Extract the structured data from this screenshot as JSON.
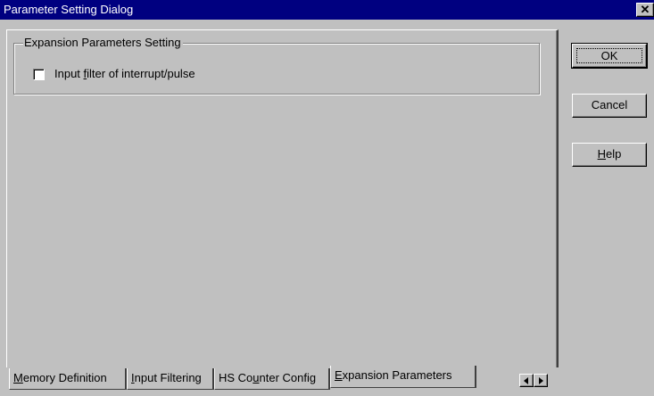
{
  "window": {
    "title": "Parameter Setting Dialog",
    "close_glyph": "✕"
  },
  "group": {
    "label": "Expansion Parameters Setting",
    "checkbox": {
      "label_pre": "Input ",
      "label_accel": "f",
      "label_post": "ilter of interrupt/pulse",
      "checked": false
    }
  },
  "buttons": {
    "ok": "OK",
    "cancel": "Cancel",
    "help_accel": "H",
    "help_rest": "elp"
  },
  "tabs": [
    {
      "accel": "M",
      "rest": "emory Definition",
      "active": false
    },
    {
      "accel": "I",
      "rest": "nput Filtering",
      "active": false
    },
    {
      "pre": "HS Co",
      "accel": "u",
      "rest": "nter Config",
      "active": false
    },
    {
      "accel": "E",
      "rest": "xpansion Parameters",
      "active": true
    }
  ]
}
